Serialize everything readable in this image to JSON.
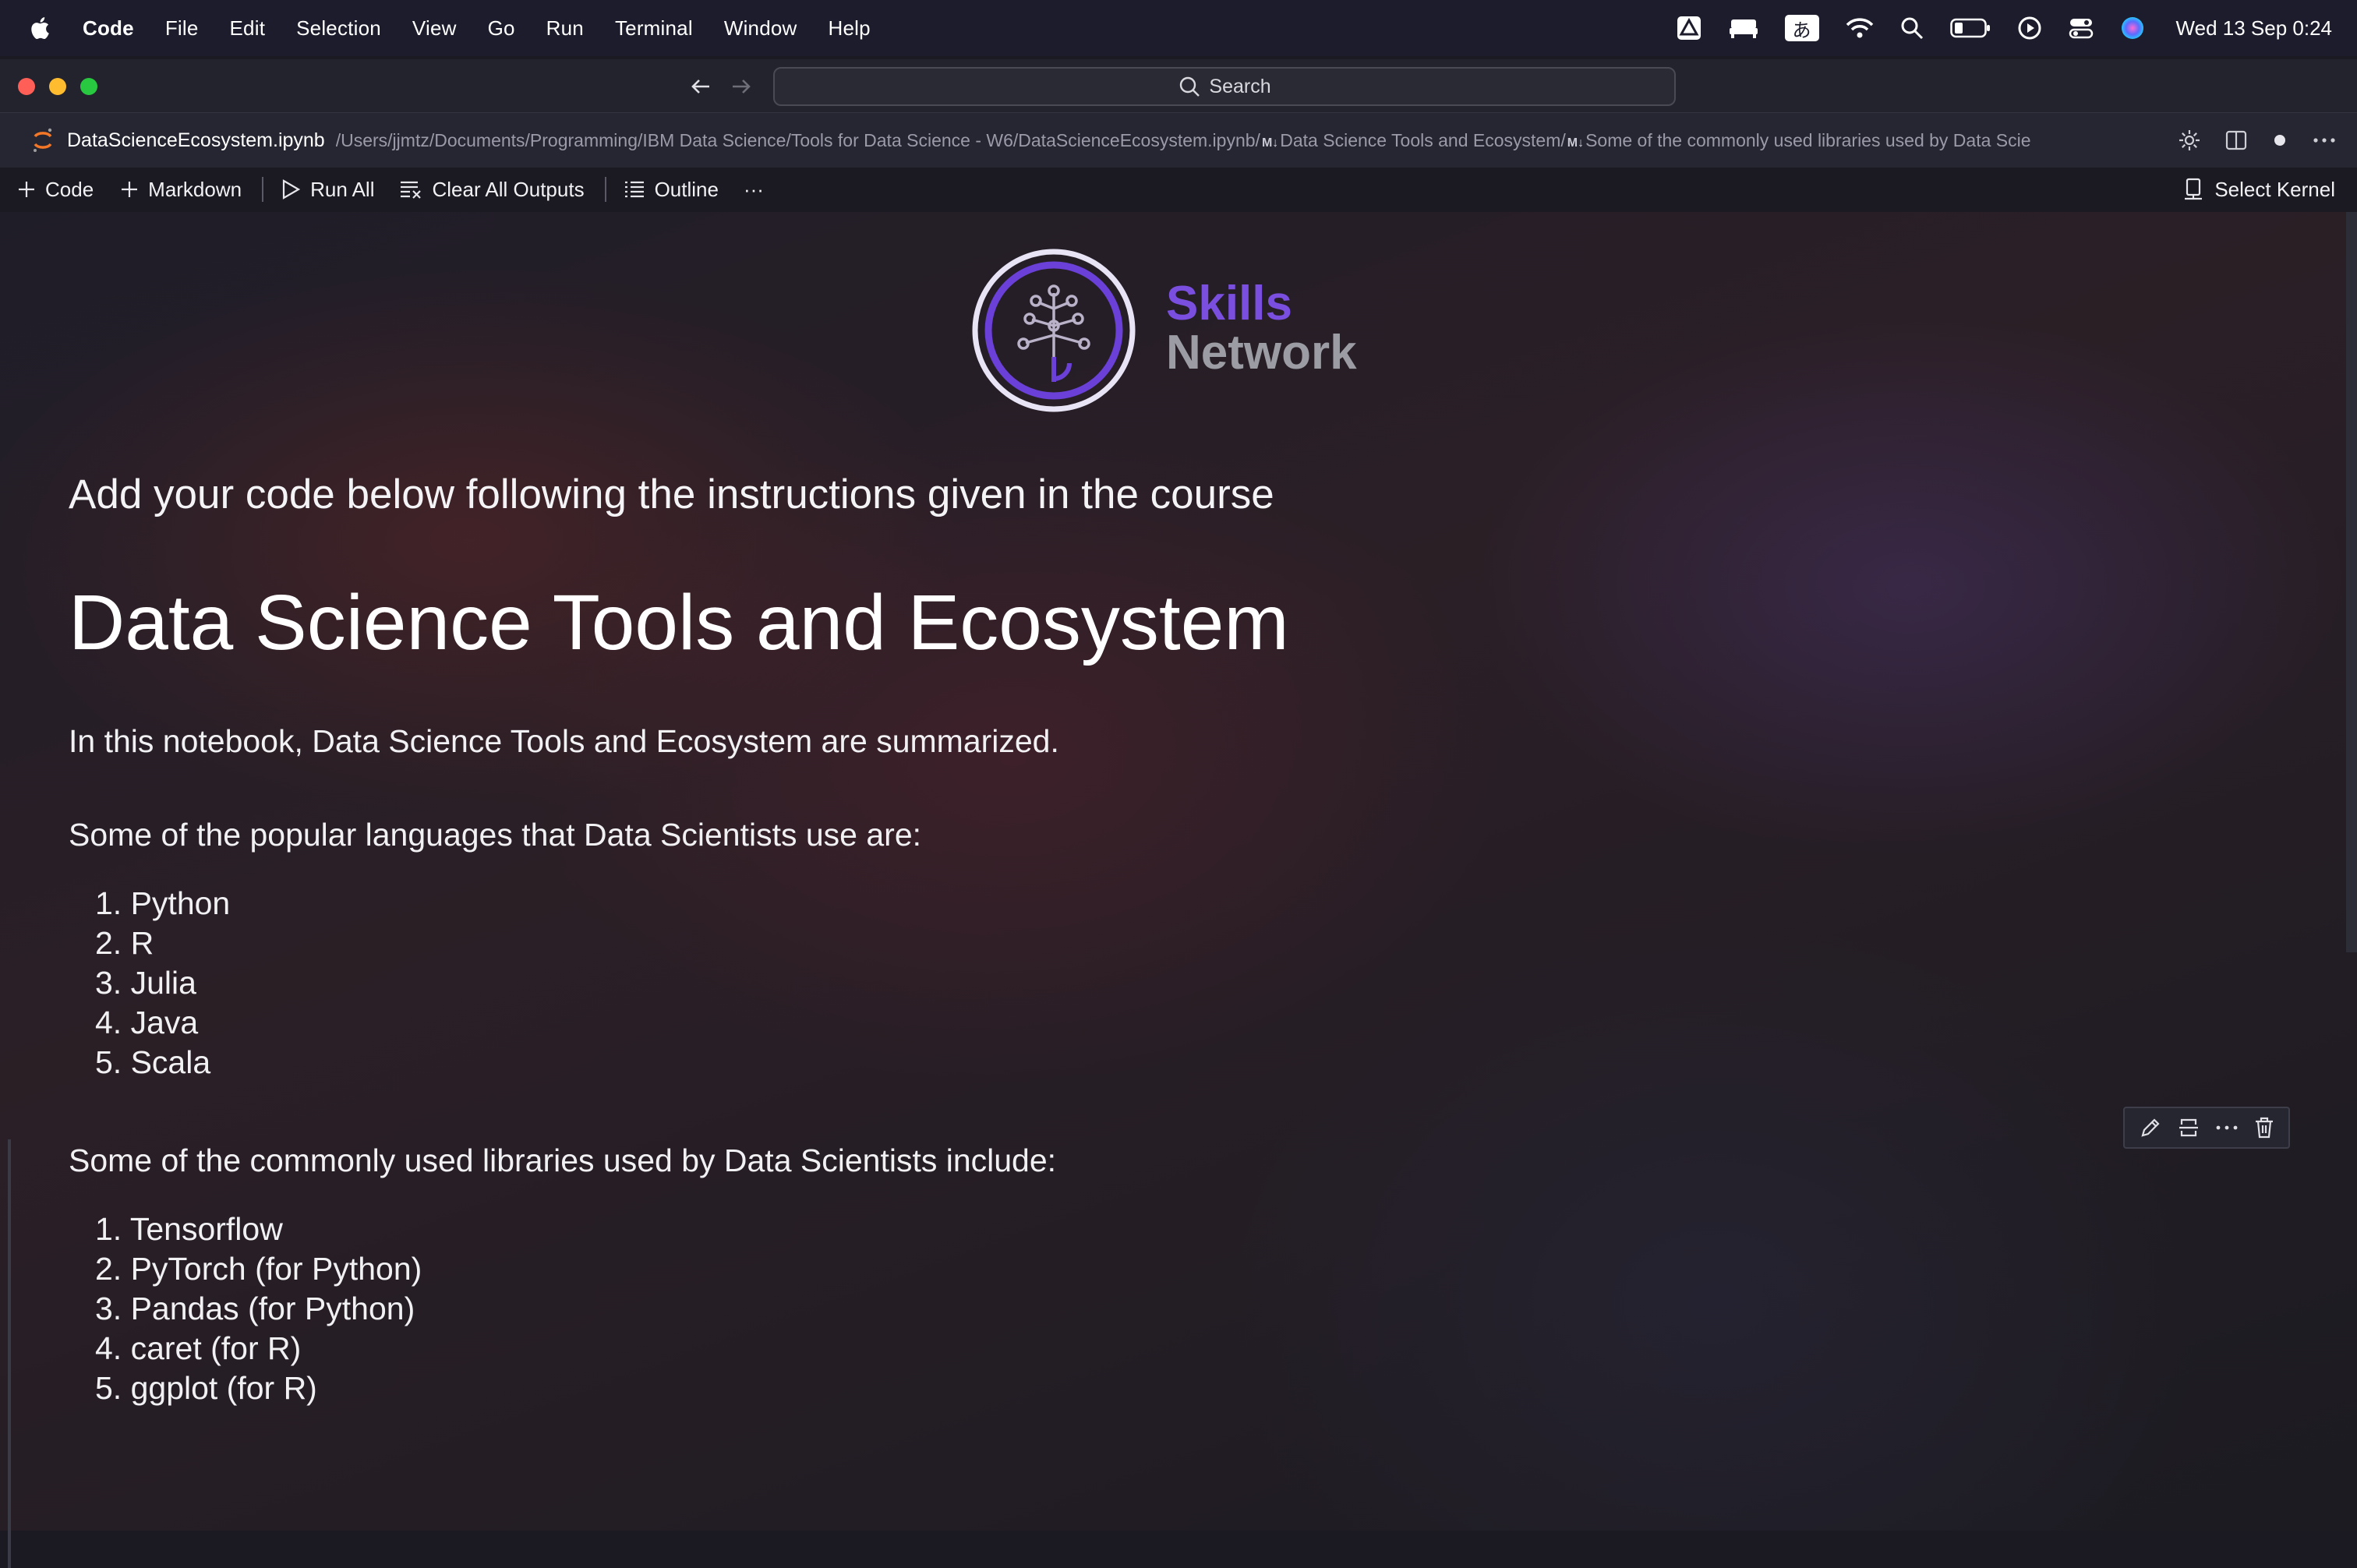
{
  "menubar": {
    "app": "Code",
    "items": [
      "File",
      "Edit",
      "Selection",
      "View",
      "Go",
      "Run",
      "Terminal",
      "Window",
      "Help"
    ],
    "input_method": "あ",
    "clock": "Wed 13 Sep  0:24"
  },
  "window": {
    "search_placeholder": "Search"
  },
  "tab": {
    "filename": "DataScienceEcosystem.ipynb",
    "path": "/Users/jjmtz/Documents/Programming/IBM Data Science/Tools for Data Science - W6/DataScienceEcosystem.ipynb/",
    "md_marker": "M↓",
    "crumb_1": "Data Science Tools and Ecosystem/",
    "crumb_2": "Some of the commonly used libraries used by Data Scie"
  },
  "toolbar": {
    "code_label": "Code",
    "markdown_label": "Markdown",
    "run_all_label": "Run All",
    "clear_outputs_label": "Clear All Outputs",
    "outline_label": "Outline",
    "more_label": "···",
    "kernel_label": "Select Kernel"
  },
  "logo": {
    "line1": "Skills",
    "line2": "Network"
  },
  "notebook": {
    "heading3": "Add your code below following the instructions given in the course",
    "heading1": "Data Science Tools and Ecosystem",
    "intro": "In this notebook, Data Science Tools and Ecosystem are summarized.",
    "languages_intro": "Some of the popular languages that Data Scientists use are:",
    "languages": [
      "1. Python",
      "2. R",
      "3. Julia",
      "4. Java",
      "5. Scala"
    ],
    "libraries_intro": "Some of the commonly used libraries used by Data Scientists include:",
    "libraries": [
      "1. Tensorflow",
      "2. PyTorch (for Python)",
      "3. Pandas (for Python)",
      "4. caret (for R)",
      "5. ggplot (for R)"
    ]
  },
  "colors": {
    "accent_purple": "#7a4fe0",
    "logo_gray": "#9c9ca4",
    "menubar_bg": "#1c1c2c"
  }
}
